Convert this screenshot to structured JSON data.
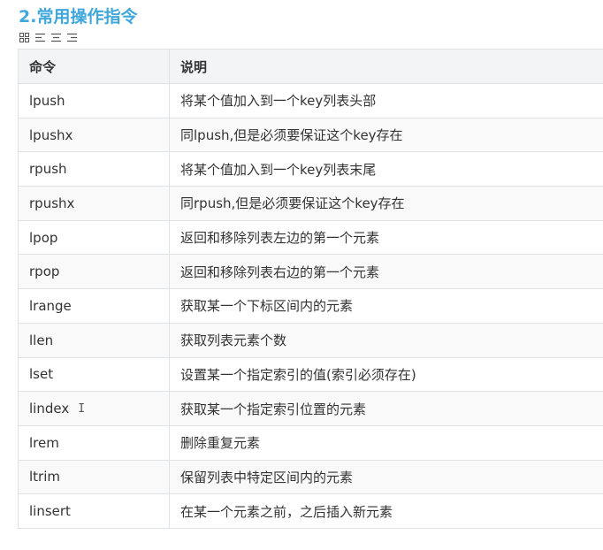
{
  "section": {
    "title": "2.常用操作指令"
  },
  "toolbar": {
    "icons": [
      "grid-view-icon",
      "align-left-icon",
      "align-center-icon",
      "align-right-icon"
    ]
  },
  "table": {
    "headers": [
      "命令",
      "说明"
    ],
    "rows": [
      {
        "command": "lpush",
        "description": "将某个值加入到一个key列表头部"
      },
      {
        "command": "lpushx",
        "description": "同lpush,但是必须要保证这个key存在"
      },
      {
        "command": "rpush",
        "description": "将某个值加入到一个key列表末尾"
      },
      {
        "command": "rpushx",
        "description": "同rpush,但是必须要保证这个key存在"
      },
      {
        "command": "lpop",
        "description": "返回和移除列表左边的第一个元素"
      },
      {
        "command": "rpop",
        "description": "返回和移除列表右边的第一个元素"
      },
      {
        "command": "lrange",
        "description": "获取某一个下标区间内的元素"
      },
      {
        "command": "llen",
        "description": "获取列表元素个数"
      },
      {
        "command": "lset",
        "description": "设置某一个指定索引的值(索引必须存在)"
      },
      {
        "command": "lindex",
        "description": "获取某一个指定索引位置的元素"
      },
      {
        "command": "lrem",
        "description": "删除重复元素"
      },
      {
        "command": "ltrim",
        "description": "保留列表中特定区间内的元素"
      },
      {
        "command": "linsert",
        "description": "在某一个元素之前，之后插入新元素"
      }
    ]
  },
  "colors": {
    "heading": "#3fa7dc",
    "border": "#dfe2e5",
    "header_bg": "#f3f4f5",
    "stripe_bg": "#f9f9f9"
  }
}
